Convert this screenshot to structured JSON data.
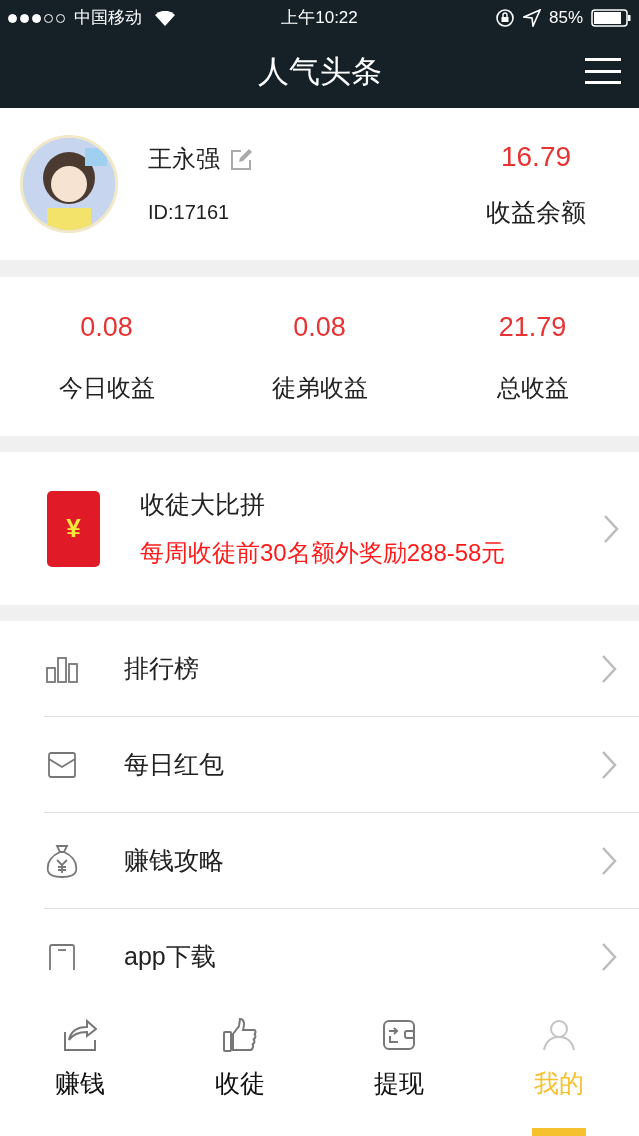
{
  "status_bar": {
    "signal_dots": [
      {
        "filled": true
      },
      {
        "filled": true
      },
      {
        "filled": true
      },
      {
        "filled": false
      },
      {
        "filled": false
      }
    ],
    "carrier": "中国移动",
    "time": "上午10:22",
    "battery": "85%"
  },
  "nav": {
    "title": "人气头条"
  },
  "profile": {
    "name": "王永强",
    "id": "ID:17161",
    "balance": "16.79",
    "balance_label": "收益余额"
  },
  "stats": [
    {
      "value": "0.08",
      "label": "今日收益"
    },
    {
      "value": "0.08",
      "label": "徒弟收益"
    },
    {
      "value": "21.79",
      "label": "总收益"
    }
  ],
  "promo": {
    "icon_sign": "¥",
    "title": "收徒大比拼",
    "subtitle": "每周收徒前30名额外奖励288-58元"
  },
  "menu": [
    {
      "kind": "chart",
      "label": "排行榜"
    },
    {
      "kind": "envelope",
      "label": "每日红包"
    },
    {
      "kind": "moneybag",
      "label": "赚钱攻略"
    },
    {
      "kind": "phone",
      "label": "app下载"
    }
  ],
  "tabs": [
    {
      "kind": "share",
      "label": "赚钱",
      "selected": false
    },
    {
      "kind": "thumb",
      "label": "收徒",
      "selected": false
    },
    {
      "kind": "wallet",
      "label": "提现",
      "selected": false
    },
    {
      "kind": "person",
      "label": "我的",
      "selected": true
    }
  ]
}
